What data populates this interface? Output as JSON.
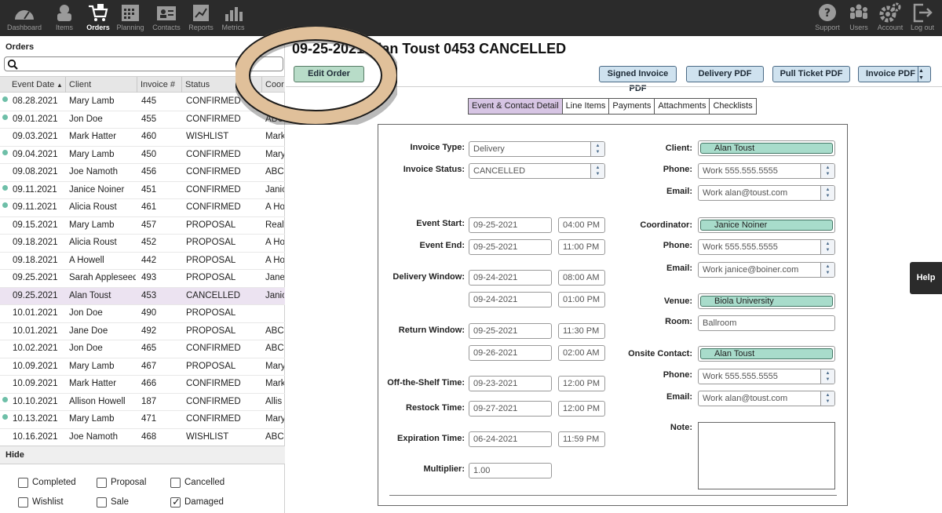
{
  "nav": {
    "left": [
      "Dashboard",
      "Items",
      "Orders",
      "Planning",
      "Contacts",
      "Reports",
      "Metrics"
    ],
    "right": [
      "Support",
      "Users",
      "Account",
      "Log out"
    ],
    "active": "Orders"
  },
  "orders": {
    "title": "Orders",
    "search_value": "",
    "columns": [
      "Event Date",
      "Client",
      "Invoice #",
      "Status",
      "Coord"
    ],
    "sort_indicator": "▲",
    "rows": [
      {
        "dot": true,
        "date": "08.28.2021",
        "client": "Mary Lamb",
        "invoice": "445",
        "status": "CONFIRMED",
        "coord": ""
      },
      {
        "dot": true,
        "date": "09.01.2021",
        "client": "Jon Doe",
        "invoice": "455",
        "status": "CONFIRMED",
        "coord": "ABC"
      },
      {
        "dot": false,
        "date": "09.03.2021",
        "client": "Mark Hatter",
        "invoice": "460",
        "status": "WISHLIST",
        "coord": "Mark"
      },
      {
        "dot": true,
        "date": "09.04.2021",
        "client": "Mary Lamb",
        "invoice": "450",
        "status": "CONFIRMED",
        "coord": "Mary"
      },
      {
        "dot": false,
        "date": "09.08.2021",
        "client": "Joe Namoth",
        "invoice": "456",
        "status": "CONFIRMED",
        "coord": "ABC"
      },
      {
        "dot": true,
        "date": "09.11.2021",
        "client": "Janice Noiner",
        "invoice": "451",
        "status": "CONFIRMED",
        "coord": "Janic"
      },
      {
        "dot": true,
        "date": "09.11.2021",
        "client": "Alicia Roust",
        "invoice": "461",
        "status": "CONFIRMED",
        "coord": "A Ho"
      },
      {
        "dot": false,
        "date": "09.15.2021",
        "client": "Mary Lamb",
        "invoice": "457",
        "status": "PROPOSAL",
        "coord": "Realt"
      },
      {
        "dot": false,
        "date": "09.18.2021",
        "client": "Alicia Roust",
        "invoice": "452",
        "status": "PROPOSAL",
        "coord": "A Ho"
      },
      {
        "dot": false,
        "date": "09.18.2021",
        "client": "A Howell",
        "invoice": "442",
        "status": "PROPOSAL",
        "coord": "A Ho"
      },
      {
        "dot": false,
        "date": "09.25.2021",
        "client": "Sarah Appleseed",
        "invoice": "493",
        "status": "PROPOSAL",
        "coord": "Jane"
      },
      {
        "dot": false,
        "date": "09.25.2021",
        "client": "Alan Toust",
        "invoice": "453",
        "status": "CANCELLED",
        "coord": "Janic",
        "selected": true
      },
      {
        "dot": false,
        "date": "10.01.2021",
        "client": "Jon Doe",
        "invoice": "490",
        "status": "PROPOSAL",
        "coord": ""
      },
      {
        "dot": false,
        "date": "10.01.2021",
        "client": "Jane Doe",
        "invoice": "492",
        "status": "PROPOSAL",
        "coord": "ABC"
      },
      {
        "dot": false,
        "date": "10.02.2021",
        "client": "Jon Doe",
        "invoice": "465",
        "status": "CONFIRMED",
        "coord": "ABC"
      },
      {
        "dot": false,
        "date": "10.09.2021",
        "client": "Mary Lamb",
        "invoice": "467",
        "status": "PROPOSAL",
        "coord": "Mary"
      },
      {
        "dot": false,
        "date": "10.09.2021",
        "client": "Mark Hatter",
        "invoice": "466",
        "status": "CONFIRMED",
        "coord": "Mark"
      },
      {
        "dot": true,
        "date": "10.10.2021",
        "client": "Allison Howell",
        "invoice": "187",
        "status": "CONFIRMED",
        "coord": "Allis"
      },
      {
        "dot": true,
        "date": "10.13.2021",
        "client": "Mary Lamb",
        "invoice": "471",
        "status": "CONFIRMED",
        "coord": "Mary"
      },
      {
        "dot": false,
        "date": "10.16.2021",
        "client": "Joe Namoth",
        "invoice": "468",
        "status": "WISHLIST",
        "coord": "ABC"
      }
    ]
  },
  "hide": {
    "title": "Hide",
    "options": [
      {
        "label": "Completed",
        "checked": false
      },
      {
        "label": "Proposal",
        "checked": false
      },
      {
        "label": "Cancelled",
        "checked": false
      },
      {
        "label": "Wishlist",
        "checked": false
      },
      {
        "label": "Sale",
        "checked": false
      },
      {
        "label": "Damaged",
        "checked": true
      }
    ]
  },
  "main": {
    "title": "09-25-2021 Alan Toust 0453 CANCELLED",
    "edit_button": "Edit Order",
    "pdf_buttons": [
      "Signed Invoice PDF",
      "Delivery PDF",
      "Pull Ticket PDF",
      "Invoice PDF"
    ],
    "tabs": [
      "Event & Contact Detail",
      "Line Items",
      "Payments",
      "Attachments",
      "Checklists"
    ],
    "active_tab": "Event & Contact Detail"
  },
  "form": {
    "invoice_type_label": "Invoice Type:",
    "invoice_type": "Delivery",
    "invoice_status_label": "Invoice Status:",
    "invoice_status": "CANCELLED",
    "event_start_label": "Event Start:",
    "event_start_date": "09-25-2021",
    "event_start_time": "04:00 PM",
    "event_end_label": "Event End:",
    "event_end_date": "09-25-2021",
    "event_end_time": "11:00 PM",
    "delivery_window_label": "Delivery Window:",
    "delivery_start_date": "09-24-2021",
    "delivery_start_time": "08:00 AM",
    "delivery_end_date": "09-24-2021",
    "delivery_end_time": "01:00 PM",
    "return_window_label": "Return Window:",
    "return_start_date": "09-25-2021",
    "return_start_time": "11:30 PM",
    "return_end_date": "09-26-2021",
    "return_end_time": "02:00 AM",
    "off_shelf_label": "Off-the-Shelf Time:",
    "off_shelf_date": "09-23-2021",
    "off_shelf_time": "12:00 PM",
    "restock_label": "Restock Time:",
    "restock_date": "09-27-2021",
    "restock_time": "12:00 PM",
    "expiration_label": "Expiration Time:",
    "expiration_date": "06-24-2021",
    "expiration_time": "11:59 PM",
    "multiplier_label": "Multiplier:",
    "multiplier": "1.00",
    "client_label": "Client:",
    "client": "Alan Toust",
    "client_phone_label": "Phone:",
    "client_phone": "Work 555.555.5555",
    "client_email_label": "Email:",
    "client_email": "Work alan@toust.com",
    "coordinator_label": "Coordinator:",
    "coordinator": "Janice Noiner",
    "coord_phone_label": "Phone:",
    "coord_phone": "Work 555.555.5555",
    "coord_email_label": "Email:",
    "coord_email": "Work janice@boiner.com",
    "venue_label": "Venue:",
    "venue": "Biola University",
    "room_label": "Room:",
    "room": "Ballroom",
    "onsite_label": "Onsite Contact:",
    "onsite": "Alan Toust",
    "onsite_phone_label": "Phone:",
    "onsite_phone": "Work 555.555.5555",
    "onsite_email_label": "Email:",
    "onsite_email": "Work alan@toust.com",
    "note_label": "Note:",
    "note": ""
  },
  "help": "Help",
  "colors": {
    "nav_bg": "#2b2b2b",
    "selected_row": "#ece3f1",
    "chip": "#a8dccb",
    "active_tab": "#d7c5e4",
    "annotation_ring": "#e0c09a"
  }
}
